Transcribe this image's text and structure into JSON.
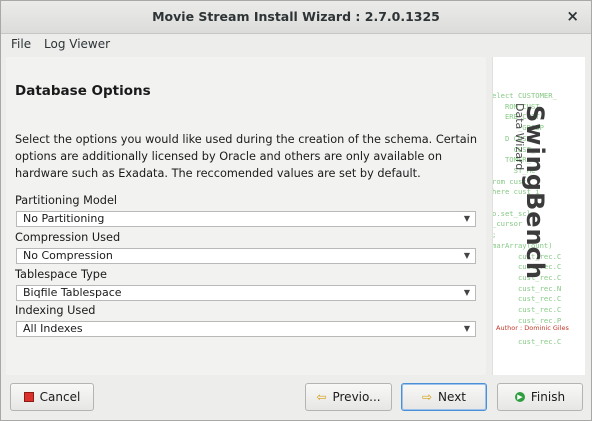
{
  "window": {
    "title": "Movie Stream Install Wizard : 2.7.0.1325",
    "close_label": "×"
  },
  "menu": {
    "items": [
      "File",
      "Log Viewer"
    ]
  },
  "page": {
    "heading": "Database Options",
    "description": "Select the options you would like used during the creation of the schema. Certain options are additionally licensed by Oracle and others are only available on hardware such as Exadata. The reccomended values are set by default."
  },
  "fields": [
    {
      "label": "Partitioning Model",
      "value": "No Partitioning"
    },
    {
      "label": "Compression Used",
      "value": "No Compression"
    },
    {
      "label": "Tablespace Type",
      "value": "Biqfile Tablespace"
    },
    {
      "label": "Indexing Used",
      "value": "All Indexes"
    }
  ],
  "side_panel": {
    "title": "SwingBench",
    "subtitle": "Data Wizard",
    "author": "Author : Dominic Giles",
    "code_lines": [
      "elect CUSTOMER_",
      "   ROM CUST",
      "   ERE CUST",
      "      _GROUP",
      "   D CUST",
      "     CUST_",
      "   TOMER_",
      "     ST_MC",
      "rom cust",
      "here cust_i",
      "",
      "o.set_scl",
      "_cursor",
      ";",
      "marArray(ount)",
      "      cust_rec.C",
      "      cust_rec.C",
      "      cust_rec.C",
      "      cust_rec.N",
      "      cust_rec.C",
      "      cust_rec.C",
      "      cust_rec.P",
      "",
      "      cust_rec.C"
    ]
  },
  "buttons": {
    "cancel": "Cancel",
    "previous": "Previo...",
    "next": "Next",
    "finish": "Finish"
  },
  "colors": {
    "accent_focus": "#4a90d9",
    "code_green": "#6fbf6f",
    "cancel_red": "#d9312c",
    "finish_green": "#2e9e3e"
  }
}
